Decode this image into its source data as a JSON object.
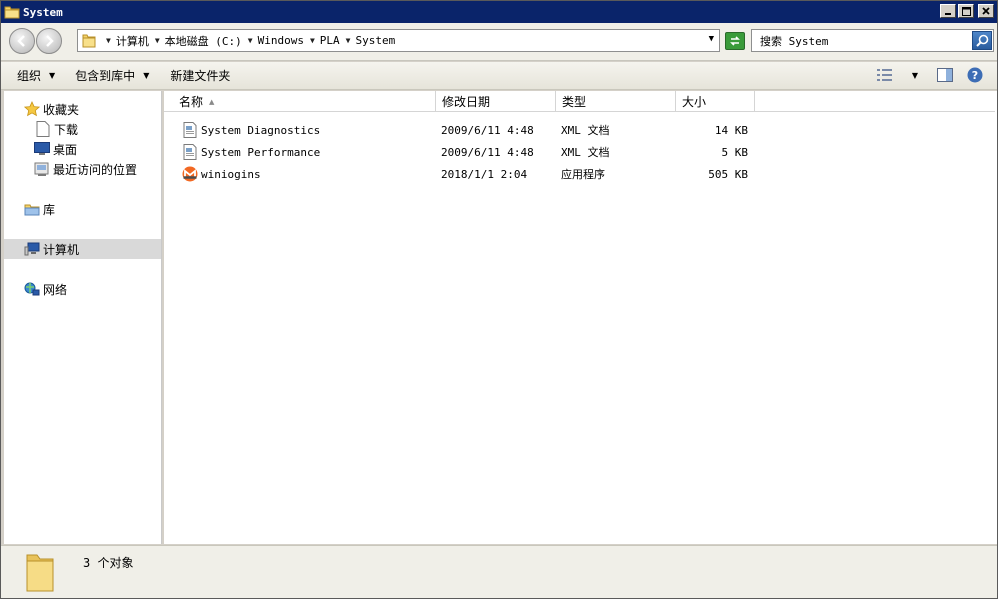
{
  "window": {
    "title": "System",
    "controls": {
      "minimize": "_",
      "maximize": "□",
      "close": "X"
    }
  },
  "addressbar": {
    "crumbs": [
      "计算机",
      "本地磁盘 (C:)",
      "Windows",
      "PLA",
      "System"
    ]
  },
  "search": {
    "value": "搜索 System"
  },
  "toolbar": {
    "organize": "组织",
    "include_in_library": "包含到库中",
    "new_folder": "新建文件夹"
  },
  "navpane": {
    "favorites": "收藏夹",
    "downloads": "下载",
    "desktop": "桌面",
    "recent": "最近访问的位置",
    "libraries": "库",
    "computer": "计算机",
    "network": "网络"
  },
  "columns": {
    "name": "名称",
    "date": "修改日期",
    "type": "类型",
    "size": "大小"
  },
  "files": [
    {
      "name": "System Diagnostics",
      "date": "2009/6/11 4:48",
      "type": "XML 文档",
      "size": "14 KB",
      "icon": "xml-file-icon"
    },
    {
      "name": "System Performance",
      "date": "2009/6/11 4:48",
      "type": "XML 文档",
      "size": "5 KB",
      "icon": "xml-file-icon"
    },
    {
      "name": "winiogins",
      "date": "2018/1/1 2:04",
      "type": "应用程序",
      "size": "505 KB",
      "icon": "monero-app-icon"
    }
  ],
  "status": {
    "count_text": "3 个对象"
  },
  "colors": {
    "titlebar": "#0a246a",
    "selection": "#d9d9d9",
    "monero_orange": "#f26822"
  }
}
